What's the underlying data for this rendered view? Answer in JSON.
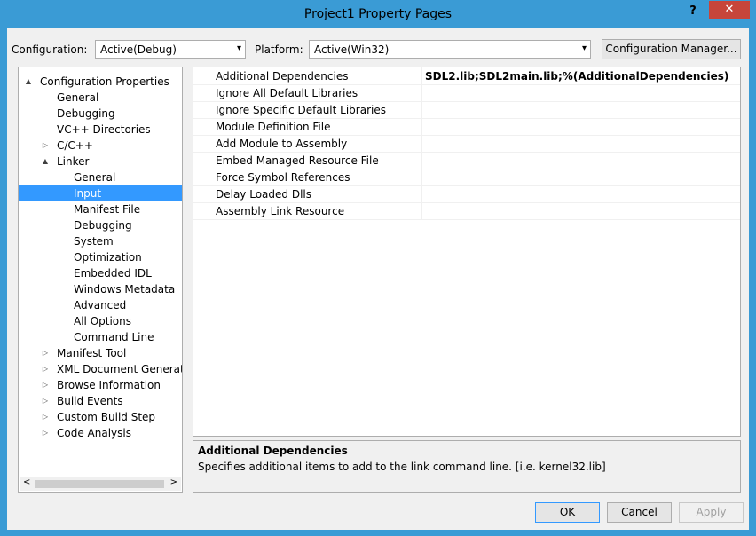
{
  "window": {
    "title": "Project1 Property Pages",
    "help": "?",
    "close": "✕"
  },
  "toolbar": {
    "configuration_label": "Configuration:",
    "configuration_value": "Active(Debug)",
    "platform_label": "Platform:",
    "platform_value": "Active(Win32)",
    "config_manager_label": "Configuration Manager..."
  },
  "tree": {
    "items": [
      {
        "label": "Configuration Properties",
        "expander": "▲"
      },
      {
        "label": "General",
        "expander": ""
      },
      {
        "label": "Debugging",
        "expander": ""
      },
      {
        "label": "VC++ Directories",
        "expander": ""
      },
      {
        "label": "C/C++",
        "expander": "▷"
      },
      {
        "label": "Linker",
        "expander": "▲"
      },
      {
        "label": "General",
        "expander": ""
      },
      {
        "label": "Input",
        "expander": ""
      },
      {
        "label": "Manifest File",
        "expander": ""
      },
      {
        "label": "Debugging",
        "expander": ""
      },
      {
        "label": "System",
        "expander": ""
      },
      {
        "label": "Optimization",
        "expander": ""
      },
      {
        "label": "Embedded IDL",
        "expander": ""
      },
      {
        "label": "Windows Metadata",
        "expander": ""
      },
      {
        "label": "Advanced",
        "expander": ""
      },
      {
        "label": "All Options",
        "expander": ""
      },
      {
        "label": "Command Line",
        "expander": ""
      },
      {
        "label": "Manifest Tool",
        "expander": "▷"
      },
      {
        "label": "XML Document Generator",
        "expander": "▷"
      },
      {
        "label": "Browse Information",
        "expander": "▷"
      },
      {
        "label": "Build Events",
        "expander": "▷"
      },
      {
        "label": "Custom Build Step",
        "expander": "▷"
      },
      {
        "label": "Code Analysis",
        "expander": "▷"
      }
    ],
    "scroll_left": "<",
    "scroll_right": ">"
  },
  "grid": {
    "rows": [
      {
        "name": "Additional Dependencies",
        "value": "SDL2.lib;SDL2main.lib;%(AdditionalDependencies)"
      },
      {
        "name": "Ignore All Default Libraries",
        "value": ""
      },
      {
        "name": "Ignore Specific Default Libraries",
        "value": ""
      },
      {
        "name": "Module Definition File",
        "value": ""
      },
      {
        "name": "Add Module to Assembly",
        "value": ""
      },
      {
        "name": "Embed Managed Resource File",
        "value": ""
      },
      {
        "name": "Force Symbol References",
        "value": ""
      },
      {
        "name": "Delay Loaded Dlls",
        "value": ""
      },
      {
        "name": "Assembly Link Resource",
        "value": ""
      }
    ]
  },
  "description": {
    "title": "Additional Dependencies",
    "text": "Specifies additional items to add to the link command line. [i.e. kernel32.lib]"
  },
  "buttons": {
    "ok": "OK",
    "cancel": "Cancel",
    "apply": "Apply"
  },
  "icons": {
    "dropdown": "chevron-down-icon",
    "expand": "expand-triangle-icon",
    "collapse": "collapse-triangle-icon"
  },
  "colors": {
    "accent": "#3a9bd5",
    "selection": "#3399ff",
    "close": "#c7453a"
  }
}
